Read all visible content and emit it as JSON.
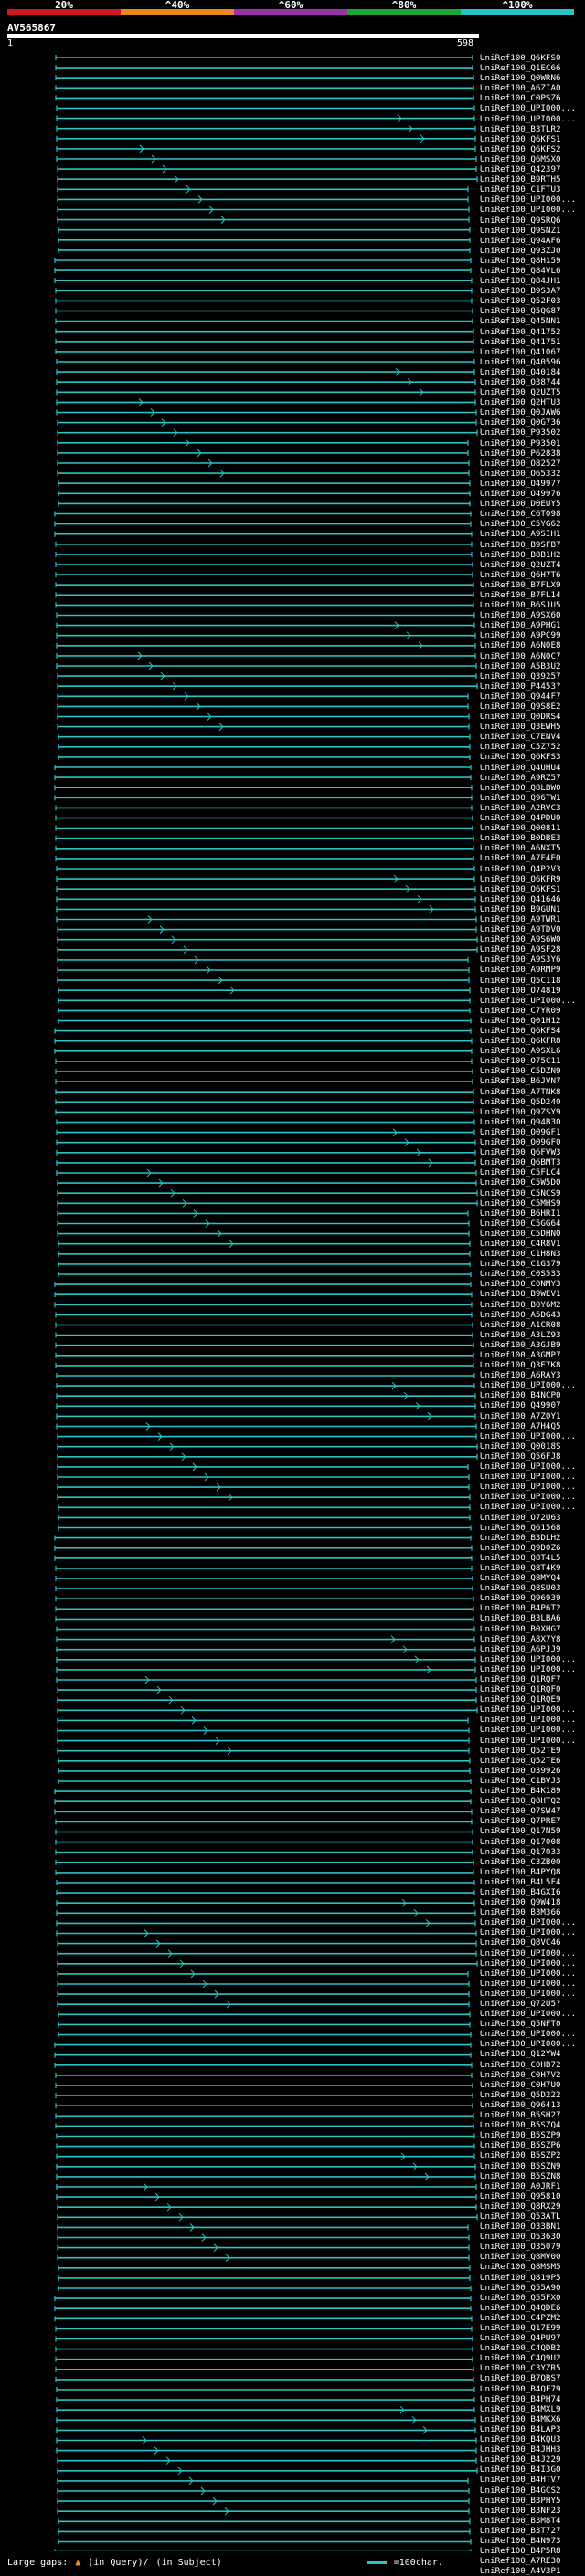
{
  "scale": {
    "segments": [
      {
        "label": "20%",
        "color": "#d0161e"
      },
      {
        "label": "^40%",
        "color": "#e88a19"
      },
      {
        "label": "^60%",
        "color": "#9a2fa7"
      },
      {
        "label": "^80%",
        "color": "#1ea62e"
      },
      {
        "label": "^100%",
        "color": "#27c3c7"
      }
    ]
  },
  "query": {
    "id": "AV565867",
    "start": "1",
    "end": "598"
  },
  "line_color": "#27c3c7",
  "hits": [
    "UniRef100_Q6KFS0",
    "UniRef100_Q1EC66",
    "UniRef100_Q0WRN6",
    "UniRef100_A6ZIA0",
    "UniRef100_C0PSZ6",
    "UniRef100_UPI000...",
    "UniRef100_UPI000...",
    "UniRef100_B3TLR2",
    "UniRef100_Q6KFS1",
    "UniRef100_Q6KFS2",
    "UniRef100_Q6MSX0",
    "UniRef100_Q42397",
    "UniRef100_B9RTH5",
    "UniRef100_C1FTU3",
    "UniRef100_UPI000...",
    "UniRef100_UPI000...",
    "UniRef100_Q9SRQ6",
    "UniRef100_Q9SNZ1",
    "UniRef100_Q94AF6",
    "UniRef100_Q93ZJ0",
    "UniRef100_Q8H159",
    "UniRef100_Q84VL6",
    "UniRef100_Q84JH1",
    "UniRef100_B9S3A7",
    "UniRef100_Q52F03",
    "UniRef100_Q5QG87",
    "UniRef100_Q45NN1",
    "UniRef100_Q41752",
    "UniRef100_Q41751",
    "UniRef100_Q41067",
    "UniRef100_Q40596",
    "UniRef100_Q40184",
    "UniRef100_Q38744",
    "UniRef100_Q2UZT5",
    "UniRef100_Q2HTU3",
    "UniRef100_Q0JAW6",
    "UniRef100_Q0G736",
    "UniRef100_P93502",
    "UniRef100_P93501",
    "UniRef100_P62838",
    "UniRef100_O82527",
    "UniRef100_O65332",
    "UniRef100_O49977",
    "UniRef100_O49976",
    "UniRef100_D0EUY5",
    "UniRef100_C6T098",
    "UniRef100_C5YG62",
    "UniRef100_A9SIH1",
    "UniRef100_B9SFB7",
    "UniRef100_B8B1H2",
    "UniRef100_Q2UZT4",
    "UniRef100_Q6H7T6",
    "UniRef100_B7FLX9",
    "UniRef100_B7FL14",
    "UniRef100_B6SJU5",
    "UniRef100_A9SX60",
    "UniRef100_A9PHG1",
    "UniRef100_A9PC99",
    "UniRef100_A6N0E8",
    "UniRef100_A6N0C7",
    "UniRef100_A5B3U2",
    "UniRef100_Q39257",
    "UniRef100_P4453?",
    "UniRef100_Q944F7",
    "UniRef100_Q9S8E2",
    "UniRef100_Q0DRS4",
    "UniRef100_Q3EWH5",
    "UniRef100_C7ENV4",
    "UniRef100_C5Z752",
    "UniRef100_Q6KFS3",
    "UniRef100_Q4UHU4",
    "UniRef100_A9RZ57",
    "UniRef100_Q8LBW0",
    "UniRef100_Q96TW1",
    "UniRef100_A2RVC3",
    "UniRef100_Q4PDU0",
    "UniRef100_Q00811",
    "UniRef100_B0DBE3",
    "UniRef100_A6NXT5",
    "UniRef100_A7F4E0",
    "UniRef100_Q4P2V3",
    "UniRef100_Q6KFR9",
    "UniRef100_Q6KFS1",
    "UniRef100_Q41646",
    "UniRef100_B9GUN1",
    "UniRef100_A9TWR1",
    "UniRef100_A9TDV0",
    "UniRef100_A9S6W0",
    "UniRef100_A9SF28",
    "UniRef100_A9S3Y6",
    "UniRef100_A9RMP9",
    "UniRef100_Q5C118",
    "UniRef100_O74819",
    "UniRef100_UPI000...",
    "UniRef100_C7YR09",
    "UniRef100_Q01H12",
    "UniRef100_Q6KFS4",
    "UniRef100_Q6KFR8",
    "UniRef100_A9SXL6",
    "UniRef100_O75C11",
    "UniRef100_C5DZN9",
    "UniRef100_B6JVN7",
    "UniRef100_A7TNK8",
    "UniRef100_Q5D240",
    "UniRef100_Q9ZSY9",
    "UniRef100_Q94B30",
    "UniRef100_Q09GF1",
    "UniRef100_Q09GF0",
    "UniRef100_Q6FVW3",
    "UniRef100_Q6BMT3",
    "UniRef100_C5FLC4",
    "UniRef100_C5W5D0",
    "UniRef100_C5NCS9",
    "UniRef100_C5MHS9",
    "UniRef100_B6HRI1",
    "UniRef100_C5GG64",
    "UniRef100_C5DHN0",
    "UniRef100_C4R8V1",
    "UniRef100_C1H8N3",
    "UniRef100_C1G379",
    "UniRef100_C0S533",
    "UniRef100_C0NMY3",
    "UniRef100_B9WEV1",
    "UniRef100_B0Y6M2",
    "UniRef100_A5DG43",
    "UniRef100_A1CR08",
    "UniRef100_A3LZ93",
    "UniRef100_A3GJB9",
    "UniRef100_A3GMP7",
    "UniRef100_Q3E7K8",
    "UniRef100_A6RAY3",
    "UniRef100_UPI000...",
    "UniRef100_B4NCP0",
    "UniRef100_Q49907",
    "UniRef100_A7Z0Y1",
    "UniRef100_A7H4Q5",
    "UniRef100_UPI000...",
    "UniRef100_Q0018S",
    "UniRef100_Q56FJ8",
    "UniRef100_UPI000...",
    "UniRef100_UPI000...",
    "UniRef100_UPI000...",
    "UniRef100_UPI000...",
    "UniRef100_UPI000...",
    "UniRef100_O72U63",
    "UniRef100_Q61568",
    "UniRef100_B3DLH2",
    "UniRef100_Q9D0Z6",
    "UniRef100_Q8T4L5",
    "UniRef100_Q8T4K9",
    "UniRef100_Q8MYQ4",
    "UniRef100_Q8SU03",
    "UniRef100_Q96939",
    "UniRef100_B4P6T2",
    "UniRef100_B3LBA6",
    "UniRef100_B0XHG7",
    "UniRef100_A8X7Y8",
    "UniRef100_A6PJJ9",
    "UniRef100_UPI000...",
    "UniRef100_UPI000...",
    "UniRef100_Q1RQF7",
    "UniRef100_Q1RQF0",
    "UniRef100_Q1RQE9",
    "UniRef100_UPI000...",
    "UniRef100_UPI000...",
    "UniRef100_UPI000...",
    "UniRef100_UPI000...",
    "UniRef100_Q52TE9",
    "UniRef100_Q52TE6",
    "UniRef100_O39926",
    "UniRef100_C1BVJ3",
    "UniRef100_B4K189",
    "UniRef100_Q8HTQ2",
    "UniRef100_O7SW47",
    "UniRef100_Q7PRE7",
    "UniRef100_Q17N59",
    "UniRef100_Q17008",
    "UniRef100_Q17033",
    "UniRef100_C3ZB00",
    "UniRef100_B4PYQ8",
    "UniRef100_B4L5F4",
    "UniRef100_B4GXI6",
    "UniRef100_Q9W418",
    "UniRef100_B3M366",
    "UniRef100_UPI000...",
    "UniRef100_UPI000...",
    "UniRef100_Q8VC46",
    "UniRef100_UPI000...",
    "UniRef100_UPI000...",
    "UniRef100_UPI000...",
    "UniRef100_UPI000...",
    "UniRef100_UPI000...",
    "UniRef100_Q72U5?",
    "UniRef100_UPI000...",
    "UniRef100_Q5NFT0",
    "UniRef100_UPI000...",
    "UniRef100_UPI000...",
    "UniRef100_Q12YW4",
    "UniRef100_C0HB72",
    "UniRef100_C0H7V2",
    "UniRef100_C0H7U0",
    "UniRef100_Q5D222",
    "UniRef100_Q96413",
    "UniRef100_B5SH27",
    "UniRef100_B5SZQ4",
    "UniRef100_B5SZP9",
    "UniRef100_B5SZP6",
    "UniRef100_B5SZP2",
    "UniRef100_B5SZN9",
    "UniRef100_B5SZN8",
    "UniRef100_A0JRF1",
    "UniRef100_Q95810",
    "UniRef100_Q8RX29",
    "UniRef100_Q53ATL",
    "UniRef100_O33BN1",
    "UniRef100_O53630",
    "UniRef100_O35079",
    "UniRef100_Q8MV00",
    "UniRef100_Q8MSM5",
    "UniRef100_Q819P5",
    "UniRef100_Q55A90",
    "UniRef100_Q55FX0",
    "UniRef100_Q4QDE6",
    "UniRef100_C4PZM2",
    "UniRef100_Q17E99",
    "UniRef100_Q4PU97",
    "UniRef100_C4QDB2",
    "UniRef100_C4Q9U2",
    "UniRef100_C3YZR5",
    "UniRef100_B7QBS7",
    "UniRef100_B4QF79",
    "UniRef100_B4PH74",
    "UniRef100_B4MXL9",
    "UniRef100_B4MKX6",
    "UniRef100_B4LAP3",
    "UniRef100_B4KQU3",
    "UniRef100_B4JHH3",
    "UniRef100_B4J229",
    "UniRef100_B4I3G0",
    "UniRef100_B4HTV7",
    "UniRef100_B4GCS2",
    "UniRef100_B3PHY5",
    "UniRef100_B3NF23",
    "UniRef100_B3M8T4",
    "UniRef100_B3T727",
    "UniRef100_B4N973",
    "UniRef100_B4P5R8",
    "UniRef100_A7RE30",
    "UniRef100_A4V3P1"
  ],
  "legend": {
    "large_gaps": "Large gaps:",
    "in_query": "(in Query)/",
    "in_subject": "(in Subject)",
    "line_scale": "=100char."
  }
}
